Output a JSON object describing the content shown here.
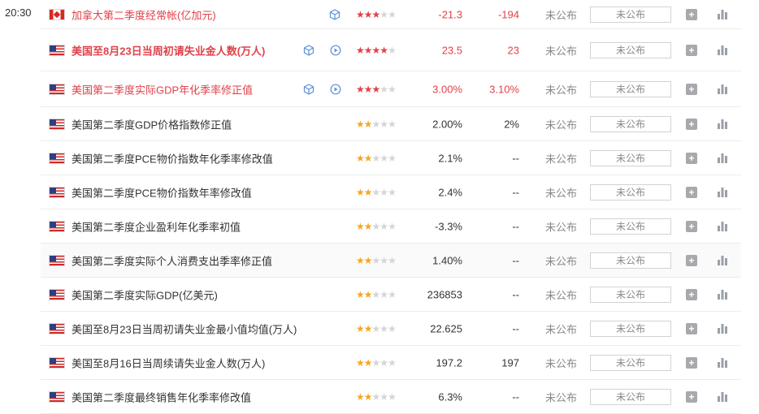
{
  "time": "20:30",
  "not_released": "未公布",
  "rows": [
    {
      "flag": "ca",
      "name": "加拿大第二季度经常帐(亿加元)",
      "name_color": "red",
      "bold": false,
      "icons": [
        "cube"
      ],
      "stars": 3,
      "star_color": "red",
      "previous": "-21.3",
      "previous_color": "red",
      "consensus": "-194",
      "consensus_color": "red"
    },
    {
      "flag": "us",
      "name": "美国至8月23日当周初请失业金人数(万人)",
      "name_color": "red",
      "bold": true,
      "icons": [
        "cube",
        "play"
      ],
      "stars": 4,
      "star_color": "red",
      "previous": "23.5",
      "previous_color": "red",
      "consensus": "23",
      "consensus_color": "red"
    },
    {
      "flag": "us",
      "name": "美国第二季度实际GDP年化季率修正值",
      "name_color": "red",
      "bold": false,
      "icons": [
        "cube",
        "play"
      ],
      "stars": 3,
      "star_color": "red",
      "previous": "3.00%",
      "previous_color": "red",
      "consensus": "3.10%",
      "consensus_color": "red"
    },
    {
      "flag": "us",
      "name": "美国第二季度GDP价格指数修正值",
      "name_color": "dark",
      "bold": false,
      "icons": [],
      "stars": 2,
      "star_color": "orange",
      "previous": "2.00%",
      "previous_color": "dark",
      "consensus": "2%",
      "consensus_color": "dark"
    },
    {
      "flag": "us",
      "name": "美国第二季度PCE物价指数年化季率修改值",
      "name_color": "dark",
      "bold": false,
      "icons": [],
      "stars": 2,
      "star_color": "orange",
      "previous": "2.1%",
      "previous_color": "dark",
      "consensus": "--",
      "consensus_color": "dark"
    },
    {
      "flag": "us",
      "name": "美国第二季度PCE物价指数年率修改值",
      "name_color": "dark",
      "bold": false,
      "icons": [],
      "stars": 2,
      "star_color": "orange",
      "previous": "2.4%",
      "previous_color": "dark",
      "consensus": "--",
      "consensus_color": "dark"
    },
    {
      "flag": "us",
      "name": "美国第二季度企业盈利年化季率初值",
      "name_color": "dark",
      "bold": false,
      "icons": [],
      "stars": 2,
      "star_color": "orange",
      "previous": "-3.3%",
      "previous_color": "dark",
      "consensus": "--",
      "consensus_color": "dark"
    },
    {
      "flag": "us",
      "name": "美国第二季度实际个人消费支出季率修正值",
      "name_color": "dark",
      "bold": false,
      "icons": [],
      "stars": 2,
      "star_color": "orange",
      "previous": "1.40%",
      "previous_color": "dark",
      "consensus": "--",
      "consensus_color": "dark",
      "shade": true
    },
    {
      "flag": "us",
      "name": "美国第二季度实际GDP(亿美元)",
      "name_color": "dark",
      "bold": false,
      "icons": [],
      "stars": 2,
      "star_color": "orange",
      "previous": "236853",
      "previous_color": "dark",
      "consensus": "--",
      "consensus_color": "dark"
    },
    {
      "flag": "us",
      "name": "美国至8月23日当周初请失业金最小值均值(万人)",
      "name_color": "dark",
      "bold": false,
      "icons": [],
      "stars": 2,
      "star_color": "orange",
      "previous": "22.625",
      "previous_color": "dark",
      "consensus": "--",
      "consensus_color": "dark"
    },
    {
      "flag": "us",
      "name": "美国至8月16日当周续请失业金人数(万人)",
      "name_color": "dark",
      "bold": false,
      "icons": [],
      "stars": 2,
      "star_color": "orange",
      "previous": "197.2",
      "previous_color": "dark",
      "consensus": "197",
      "consensus_color": "dark"
    },
    {
      "flag": "us",
      "name": "美国第二季度最终销售年化季率修改值",
      "name_color": "dark",
      "bold": false,
      "icons": [],
      "stars": 2,
      "star_color": "orange",
      "previous": "6.3%",
      "previous_color": "dark",
      "consensus": "--",
      "consensus_color": "dark"
    }
  ],
  "colors": {
    "red": "#e0424a",
    "orange": "#f5a623",
    "gray_star": "#d5d5d5",
    "icon_blue": "#5c8fd6"
  }
}
